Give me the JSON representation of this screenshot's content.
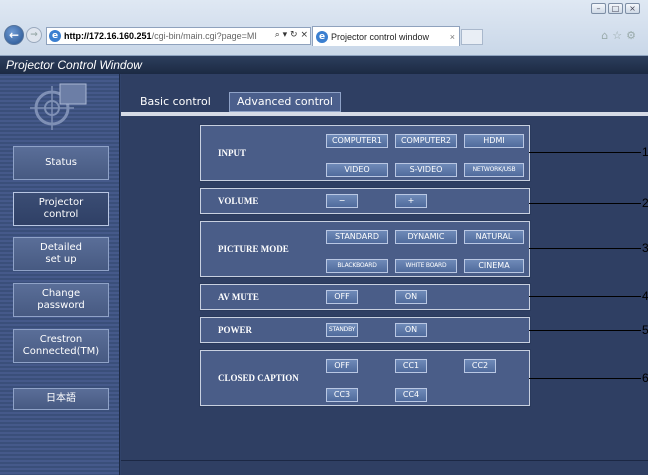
{
  "browser": {
    "url_host": "http://172.16.160.251",
    "url_path": "/cgi-bin/main.cgi?page=MI",
    "url_tools": "⌕ ▾ ↻ ×",
    "tab_title": "Projector control window",
    "tab_close": "×"
  },
  "window": {
    "title": "Projector Control Window"
  },
  "sidebar": {
    "items": [
      {
        "label": "Status"
      },
      {
        "label": "Projector\ncontrol"
      },
      {
        "label": "Detailed\nset up"
      },
      {
        "label": "Change\npassword"
      },
      {
        "label": "Crestron\nConnected(TM)"
      },
      {
        "label": "日本語"
      }
    ]
  },
  "tabs": {
    "basic": "Basic control",
    "advanced": "Advanced control"
  },
  "controls": {
    "input": {
      "label": "INPUT",
      "buttons": [
        "COMPUTER1",
        "COMPUTER2",
        "HDMI",
        "VIDEO",
        "S-VIDEO",
        "NETWORK/USB"
      ]
    },
    "volume": {
      "label": "VOLUME",
      "buttons": [
        "−",
        "+"
      ]
    },
    "picture_mode": {
      "label": "PICTURE MODE",
      "buttons": [
        "STANDARD",
        "DYNAMIC",
        "NATURAL",
        "BLACKBOARD",
        "WHITE BOARD",
        "CINEMA"
      ]
    },
    "av_mute": {
      "label": "AV MUTE",
      "buttons": [
        "OFF",
        "ON"
      ]
    },
    "power": {
      "label": "POWER",
      "buttons": [
        "STANDBY",
        "ON"
      ]
    },
    "closed_caption": {
      "label": "CLOSED CAPTION",
      "buttons": [
        "OFF",
        "CC1",
        "CC2",
        "CC3",
        "CC4"
      ]
    }
  },
  "callouts": [
    "1",
    "2",
    "3",
    "4",
    "5",
    "6"
  ]
}
